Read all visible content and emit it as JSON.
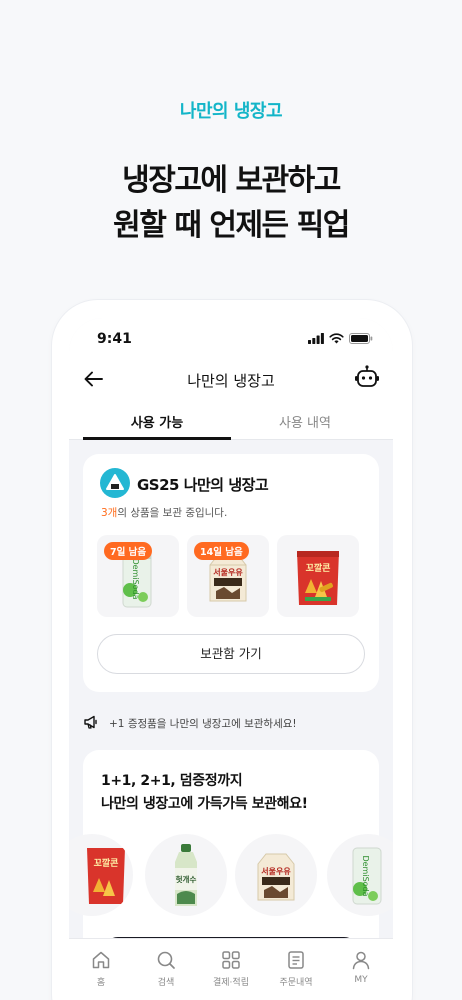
{
  "promo": {
    "eyebrow": "나만의 냉장고",
    "title_line1": "냉장고에 보관하고",
    "title_line2": "원할 때 언제든 픽업"
  },
  "status_bar": {
    "time": "9:41"
  },
  "nav": {
    "title": "나만의 냉장고"
  },
  "tabs": [
    {
      "label": "사용 가능",
      "active": true
    },
    {
      "label": "사용 내역",
      "active": false
    }
  ],
  "fridge_card": {
    "title": "GS25 나만의 냉장고",
    "kept_count": "3개",
    "kept_suffix": "의 상품을 보관 중입니다.",
    "products": [
      {
        "name": "DemiSoda",
        "badge": "7일 남음"
      },
      {
        "name": "서울우유",
        "badge": "14일 남음"
      },
      {
        "name": "꼬깔콘",
        "badge": ""
      }
    ],
    "button_label": "보관함 가기"
  },
  "notice": {
    "text": "+1 증정품을 나만의 냉장고에 보관하세요!"
  },
  "promo_card": {
    "line1": "1+1, 2+1, 덤증정까지",
    "line2": "나만의 냉장고에 가득가득 보관해요!",
    "products": [
      "꼬깔콘",
      "헛개수",
      "서울우유",
      "DemiSoda"
    ]
  },
  "bottom_nav": [
    {
      "label": "홈",
      "icon": "home-icon"
    },
    {
      "label": "검색",
      "icon": "search-icon"
    },
    {
      "label": "결제·적립",
      "icon": "payment-icon"
    },
    {
      "label": "주문내역",
      "icon": "order-history-icon"
    },
    {
      "label": "MY",
      "icon": "profile-icon"
    }
  ],
  "colors": {
    "accent": "#13b5c8",
    "badge": "#ff6a21",
    "count_highlight": "#ff6b1a",
    "background": "#f7f8fa"
  }
}
